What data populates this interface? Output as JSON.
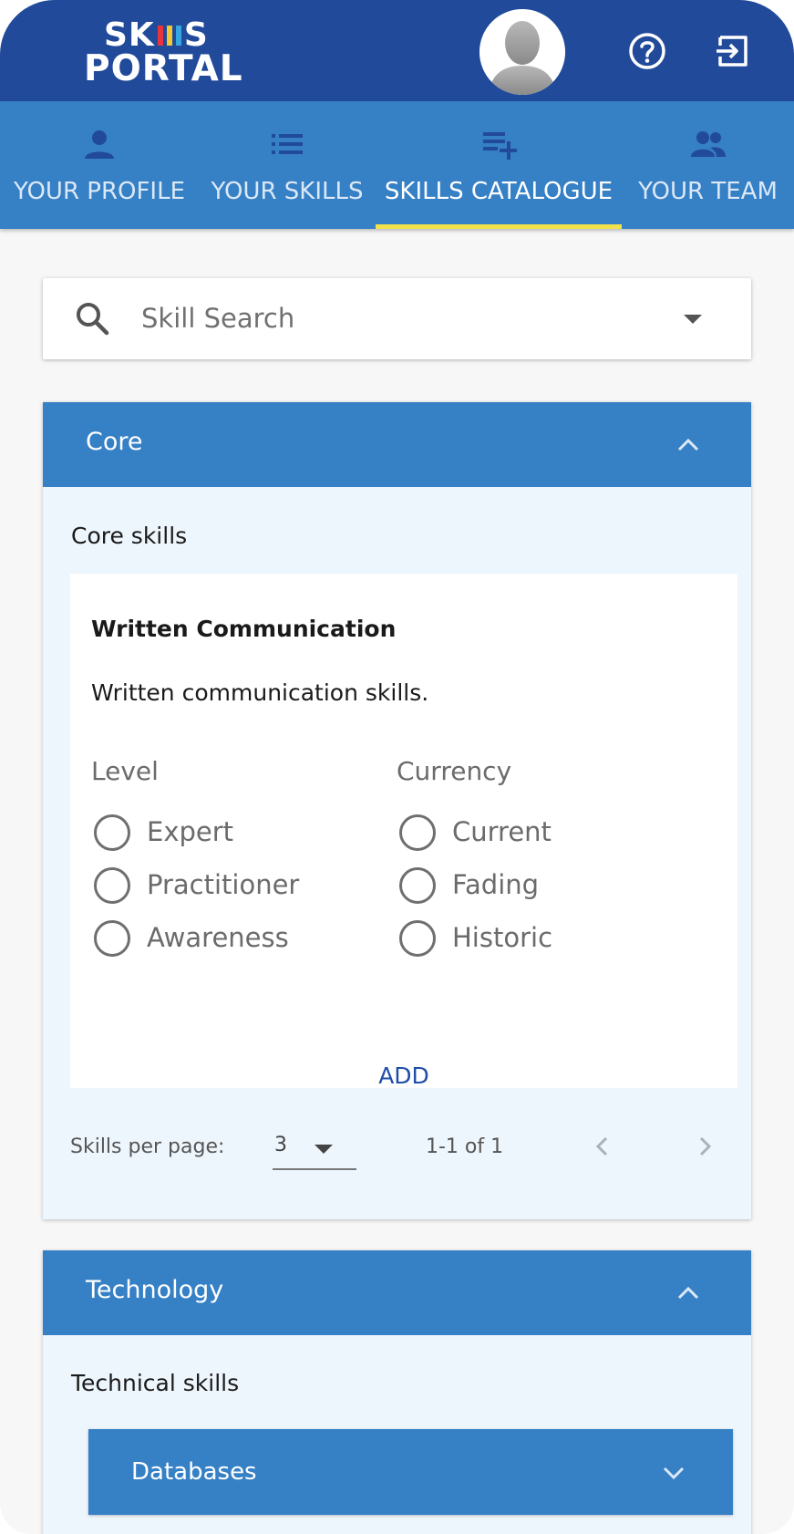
{
  "app": {
    "logo_line1_left": "SK",
    "logo_line1_right": "S",
    "logo_line2": "PORTAL",
    "logo_bar_colors": [
      "#e8343d",
      "#f2c830",
      "#35a7e0"
    ]
  },
  "header": {
    "avatar_icon": "user-avatar-icon",
    "help_icon": "help-circle-icon",
    "logout_icon": "logout-icon"
  },
  "nav": {
    "tabs": [
      {
        "label": "YOUR PROFILE",
        "icon": "person-icon"
      },
      {
        "label": "YOUR SKILLS",
        "icon": "list-icon"
      },
      {
        "label": "SKILLS CATALOGUE",
        "icon": "playlist-add-icon",
        "active": true
      },
      {
        "label": "YOUR TEAM",
        "icon": "group-icon"
      }
    ]
  },
  "search": {
    "placeholder": "Skill Search",
    "value": ""
  },
  "categories": [
    {
      "title": "Core",
      "description": "Core skills",
      "expanded": true,
      "skills": [
        {
          "name": "Written Communication",
          "description": "Written communication skills.",
          "level_label": "Level",
          "levels": [
            "Expert",
            "Practitioner",
            "Awareness"
          ],
          "currency_label": "Currency",
          "currencies": [
            "Current",
            "Fading",
            "Historic"
          ],
          "add_label": "ADD"
        }
      ],
      "pager": {
        "per_page_label": "Skills per page:",
        "per_page": "3",
        "range": "1-1 of 1"
      }
    },
    {
      "title": "Technology",
      "description": "Technical skills",
      "expanded": true,
      "subcategories": [
        {
          "title": "Databases",
          "expanded": false
        }
      ]
    }
  ],
  "colors": {
    "header": "#214a9a",
    "tabs": "#3680c6",
    "tab_indicator": "#f2e24a",
    "panel_header": "#3680c6",
    "panel_body": "#eef6fd",
    "accent_link": "#1f4ea8"
  }
}
